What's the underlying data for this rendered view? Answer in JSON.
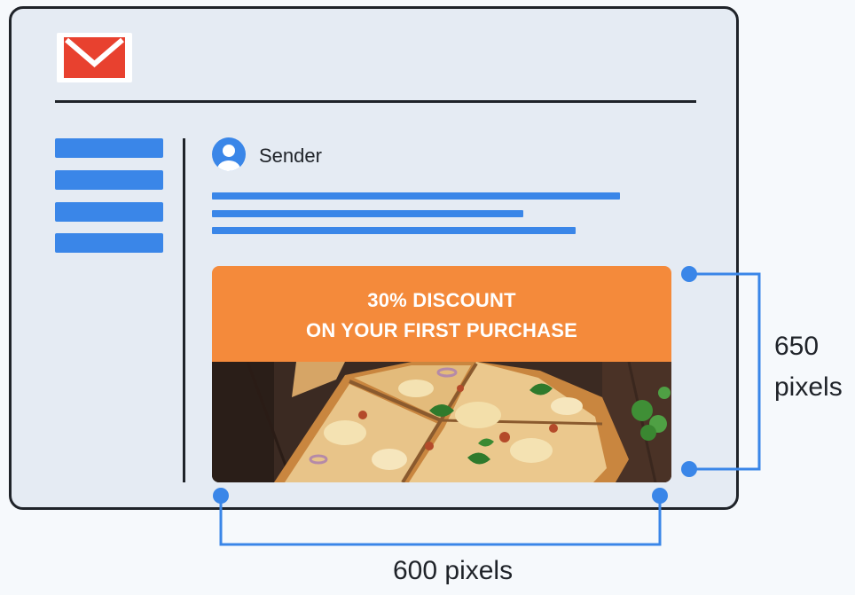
{
  "email": {
    "sender": "Sender"
  },
  "promo": {
    "line1": "30% DISCOUNT",
    "line2": "ON YOUR FIRST PURCHASE"
  },
  "dimensions": {
    "height_value": "650",
    "height_unit": "pixels",
    "width_label": "600 pixels"
  },
  "colors": {
    "accent_blue": "#3a86e8",
    "promo_orange": "#f48a3b",
    "logo_red": "#e8412f",
    "window_bg": "#e5ebf3",
    "outline": "#1f2329"
  },
  "icons": [
    "mail-logo-icon",
    "user-avatar-icon"
  ]
}
